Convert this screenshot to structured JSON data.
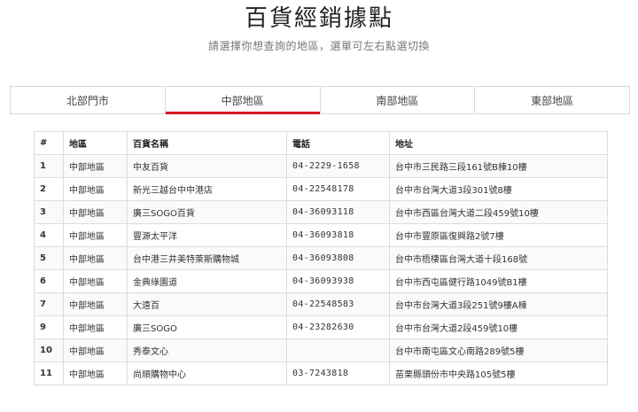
{
  "header": {
    "title": "百貨經銷據點",
    "subtitle": "請選擇你想查詢的地區，選單可左右點選切換"
  },
  "tabs": [
    {
      "label": "北部門市",
      "active": false
    },
    {
      "label": "中部地區",
      "active": true
    },
    {
      "label": "南部地區",
      "active": false
    },
    {
      "label": "東部地區",
      "active": false
    }
  ],
  "colors": {
    "accent": "#d7141f",
    "border": "#dcdcdc"
  },
  "table": {
    "columns": [
      "#",
      "地區",
      "百貨名稱",
      "電話",
      "地址"
    ],
    "rows": [
      {
        "no": "1",
        "region": "中部地區",
        "name": "中友百貨",
        "phone": "04-2229-1658",
        "address": "台中市三民路三段161號B棟10樓"
      },
      {
        "no": "2",
        "region": "中部地區",
        "name": "新光三越台中中港店",
        "phone": "04-22548178",
        "address": "台中市台灣大道3段301號8樓"
      },
      {
        "no": "3",
        "region": "中部地區",
        "name": "廣三SOGO百貨",
        "phone": "04-36093118",
        "address": "台中市西區台灣大道二段459號10樓"
      },
      {
        "no": "4",
        "region": "中部地區",
        "name": "豐源太平洋",
        "phone": "04-36093818",
        "address": "台中市豐原區復興路2號7樓"
      },
      {
        "no": "5",
        "region": "中部地區",
        "name": "台中港三井美特萊斯購物城",
        "phone": "04-36093808",
        "address": "台中市梧棲區台灣大道十段168號"
      },
      {
        "no": "6",
        "region": "中部地區",
        "name": "金典綠園道",
        "phone": "04-36093938",
        "address": "台中市西屯區健行路1049號B1樓"
      },
      {
        "no": "7",
        "region": "中部地區",
        "name": "大遠百",
        "phone": "04-22548583",
        "address": "台中市台灣大道3段251號9樓A棟"
      },
      {
        "no": "9",
        "region": "中部地區",
        "name": "廣三SOGO",
        "phone": "04-23282630",
        "address": "台中市台灣大道2段459號10樓"
      },
      {
        "no": "10",
        "region": "中部地區",
        "name": "秀泰文心",
        "phone": "",
        "address": "台中市南屯區文心南路289號5樓"
      },
      {
        "no": "11",
        "region": "中部地區",
        "name": "尚順購物中心",
        "phone": "03-7243818",
        "address": "苗栗縣頭份市中央路105號5樓"
      }
    ]
  }
}
